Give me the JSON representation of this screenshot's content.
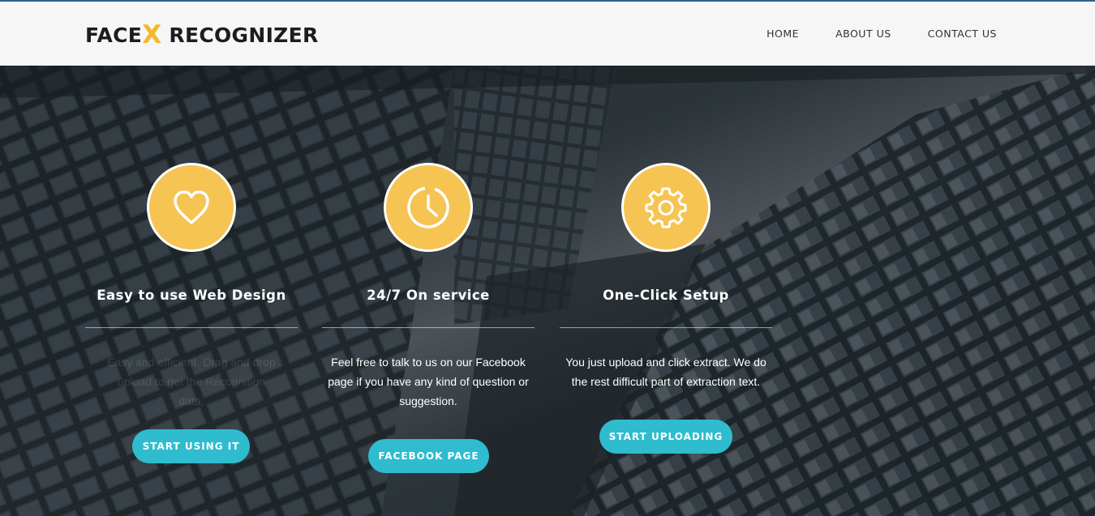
{
  "header": {
    "logo_part1": "FACE",
    "logo_x": "X",
    "logo_part2": "RECOGNIZER",
    "nav": [
      "HOME",
      "ABOUT US",
      "CONTACT US"
    ]
  },
  "features": [
    {
      "icon": "heart-icon",
      "title": "Easy to use Web Design",
      "text": "Easy and efficient. Drag and drop upload to get the Recognition data.",
      "button": "START USING IT"
    },
    {
      "icon": "clock-icon",
      "title": "24/7 On service",
      "text": "Feel free to talk to us on our Facebook page if you have any kind of question or suggestion.",
      "button": "FACEBOOK PAGE"
    },
    {
      "icon": "gear-icon",
      "title": "One-Click Setup",
      "text": "You just upload and click extract. We do the rest difficult part of extraction text.",
      "button": "START UPLOADING"
    }
  ],
  "colors": {
    "accent_yellow": "#f6c453",
    "button_teal": "#2fbccf",
    "header_bg": "#f6f6f6"
  }
}
